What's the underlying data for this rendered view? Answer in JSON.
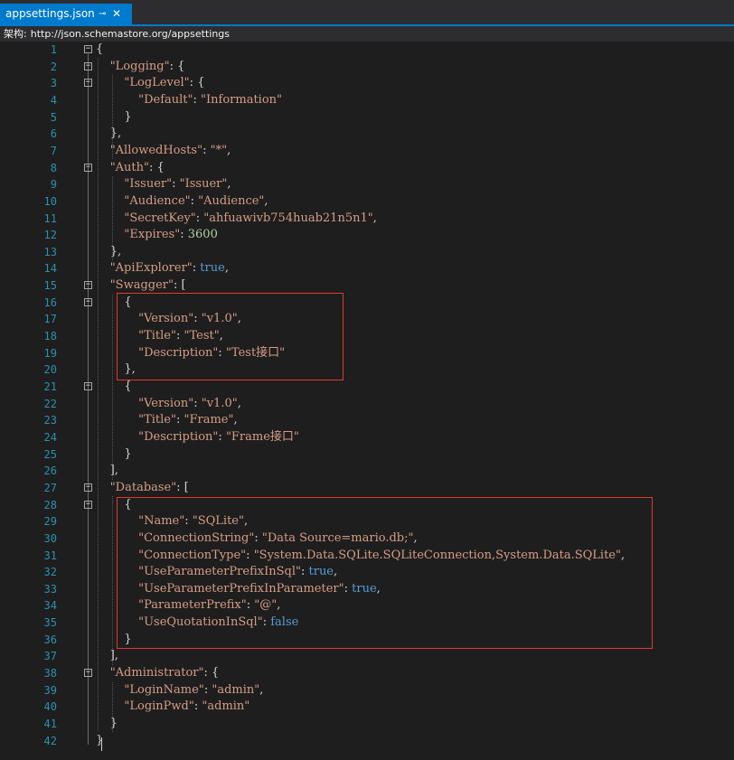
{
  "tab": {
    "title": "appsettings.json",
    "pin": "⊸",
    "close": "✕"
  },
  "schema": {
    "label": "架构:",
    "url": "http://json.schemastore.org/appsettings"
  },
  "lines": [
    {
      "n": "1",
      "code": "{"
    },
    {
      "n": "2",
      "code": "  \"Logging\": {"
    },
    {
      "n": "3",
      "code": "    \"LogLevel\": {"
    },
    {
      "n": "4",
      "code": "      \"Default\": \"Information\""
    },
    {
      "n": "5",
      "code": "    }"
    },
    {
      "n": "6",
      "code": "  },"
    },
    {
      "n": "7",
      "code": "  \"AllowedHosts\": \"*\","
    },
    {
      "n": "8",
      "code": "  \"Auth\": {"
    },
    {
      "n": "9",
      "code": "    \"Issuer\": \"Issuer\","
    },
    {
      "n": "10",
      "code": "    \"Audience\": \"Audience\","
    },
    {
      "n": "11",
      "code": "    \"SecretKey\": \"ahfuawivb754huab21n5n1\","
    },
    {
      "n": "12",
      "code": "    \"Expires\": 3600"
    },
    {
      "n": "13",
      "code": "  },"
    },
    {
      "n": "14",
      "code": "  \"ApiExplorer\": true,"
    },
    {
      "n": "15",
      "code": "  \"Swagger\": ["
    },
    {
      "n": "16",
      "code": "    {"
    },
    {
      "n": "17",
      "code": "      \"Version\": \"v1.0\","
    },
    {
      "n": "18",
      "code": "      \"Title\": \"Test\","
    },
    {
      "n": "19",
      "code": "      \"Description\": \"Test接口\""
    },
    {
      "n": "20",
      "code": "    },"
    },
    {
      "n": "21",
      "code": "    {"
    },
    {
      "n": "22",
      "code": "      \"Version\": \"v1.0\","
    },
    {
      "n": "23",
      "code": "      \"Title\": \"Frame\","
    },
    {
      "n": "24",
      "code": "      \"Description\": \"Frame接口\""
    },
    {
      "n": "25",
      "code": "    }"
    },
    {
      "n": "26",
      "code": "  ],"
    },
    {
      "n": "27",
      "code": "  \"Database\": ["
    },
    {
      "n": "28",
      "code": "    {"
    },
    {
      "n": "29",
      "code": "      \"Name\": \"SQLite\","
    },
    {
      "n": "30",
      "code": "      \"ConnectionString\": \"Data Source=mario.db;\","
    },
    {
      "n": "31",
      "code": "      \"ConnectionType\": \"System.Data.SQLite.SQLiteConnection,System.Data.SQLite\","
    },
    {
      "n": "32",
      "code": "      \"UseParameterPrefixInSql\": true,"
    },
    {
      "n": "33",
      "code": "      \"UseParameterPrefixInParameter\": true,"
    },
    {
      "n": "34",
      "code": "      \"ParameterPrefix\": \"@\","
    },
    {
      "n": "35",
      "code": "      \"UseQuotationInSql\": false"
    },
    {
      "n": "36",
      "code": "    }"
    },
    {
      "n": "37",
      "code": "  ],"
    },
    {
      "n": "38",
      "code": "  \"Administrator\": {"
    },
    {
      "n": "39",
      "code": "    \"LoginName\": \"admin\","
    },
    {
      "n": "40",
      "code": "    \"LoginPwd\": \"admin\""
    },
    {
      "n": "41",
      "code": "  }"
    },
    {
      "n": "42",
      "code": "}"
    }
  ],
  "foldable_lines": [
    "1",
    "2",
    "3",
    "8",
    "15",
    "16",
    "21",
    "27",
    "28",
    "38"
  ],
  "colors": {
    "background": "#1e1e1e",
    "tab_active": "#007acc",
    "line_number": "#2b91af",
    "string": "#d69d85",
    "keyword": "#569cd6",
    "number": "#b5cea8",
    "punctuation": "#d4d4d4",
    "highlight_box": "#e0392b"
  }
}
